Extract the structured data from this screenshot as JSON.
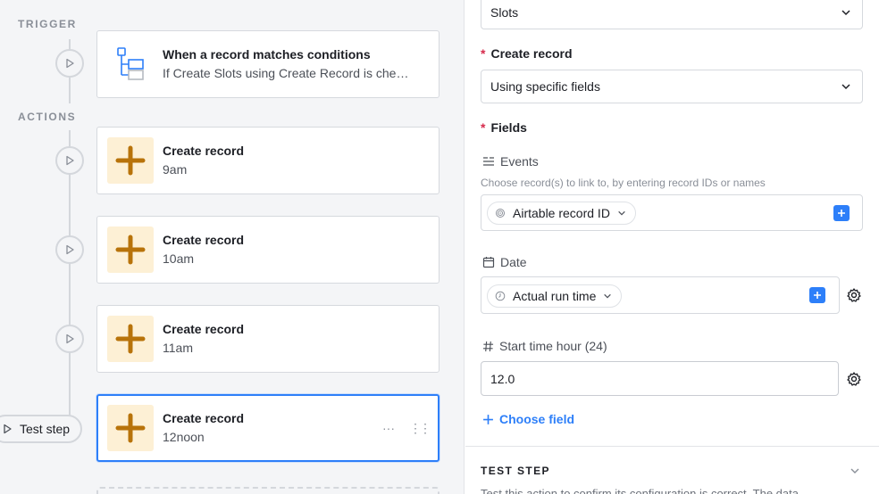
{
  "left": {
    "trigger_label": "TRIGGER",
    "actions_label": "ACTIONS",
    "trigger_card": {
      "title": "When a record matches conditions",
      "subtitle": "If Create Slots using Create Record is che…"
    },
    "action_cards": [
      {
        "title": "Create record",
        "subtitle": "9am"
      },
      {
        "title": "Create record",
        "subtitle": "10am"
      },
      {
        "title": "Create record",
        "subtitle": "11am"
      },
      {
        "title": "Create record",
        "subtitle": "12noon"
      }
    ],
    "test_step_label": "Test step",
    "more_glyph": "···",
    "drag_glyph": "⋮⋮"
  },
  "right": {
    "table_select": "Slots",
    "create_record_label": "Create record",
    "create_record_select": "Using specific fields",
    "fields_label": "Fields",
    "required_mark": "*",
    "events": {
      "label": "Events",
      "hint": "Choose record(s) to link to, by entering record IDs or names",
      "pill": "Airtable record ID"
    },
    "date": {
      "label": "Date",
      "pill": "Actual run time"
    },
    "start_time": {
      "label": "Start time hour (24)",
      "value": "12.0"
    },
    "choose_field": "Choose field",
    "test_step_title": "TEST STEP",
    "test_step_desc": "Test this action to confirm its configuration is correct. The data"
  },
  "colors": {
    "accent": "#2d7ff9",
    "action_icon_bg": "#fdf0d5",
    "action_icon": "#b8730a",
    "required": "#d62b4c"
  }
}
